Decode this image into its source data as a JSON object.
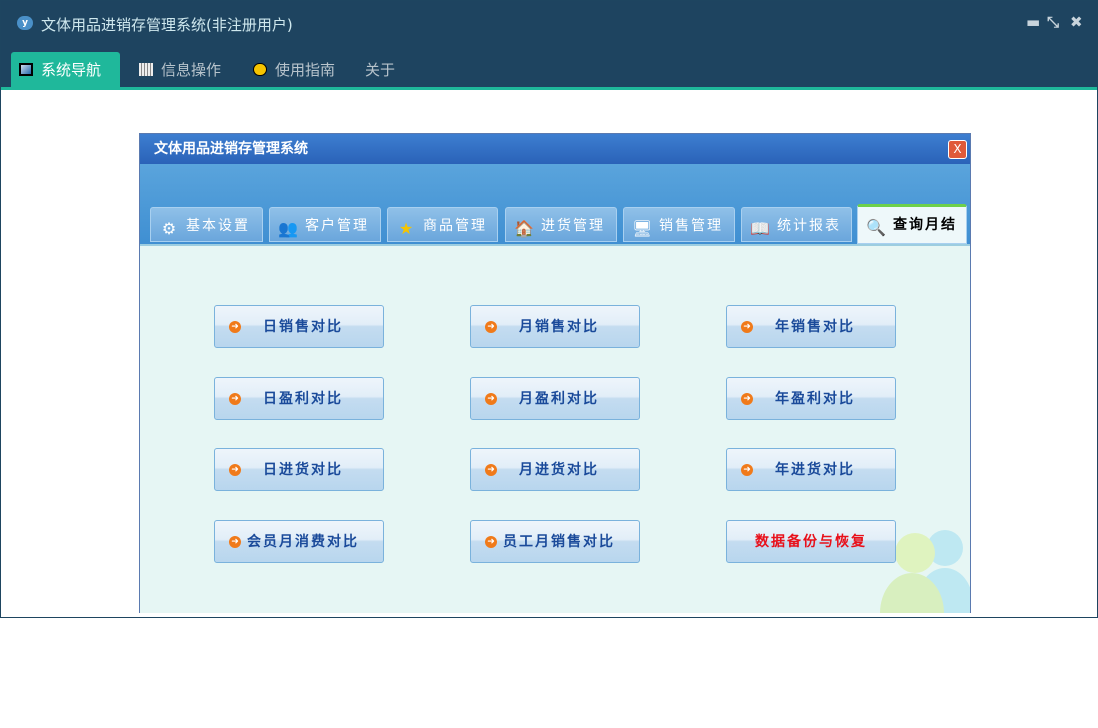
{
  "window": {
    "title": "文体用品进销存管理系统(非注册用户)",
    "minimize": "▬",
    "restore": "⤡",
    "close": "✖"
  },
  "menu": [
    {
      "label": "系统导航",
      "icon": "monitor-icon",
      "active": true
    },
    {
      "label": "信息操作",
      "icon": "grid-icon"
    },
    {
      "label": "使用指南",
      "icon": "help-icon"
    },
    {
      "label": "关于"
    }
  ],
  "inner": {
    "title": "文体用品进销存管理系统",
    "close": "X",
    "tabs": [
      {
        "label": "基本设置",
        "icon": "gear-icon"
      },
      {
        "label": "客户管理",
        "icon": "users-icon"
      },
      {
        "label": "商品管理",
        "icon": "star-icon"
      },
      {
        "label": "进货管理",
        "icon": "house-icon"
      },
      {
        "label": "销售管理",
        "icon": "monitor-icon"
      },
      {
        "label": "统计报表",
        "icon": "book-icon"
      },
      {
        "label": "查询月结",
        "icon": "search-icon",
        "active": true
      }
    ],
    "buttons": [
      "日销售对比",
      "月销售对比",
      "年销售对比",
      "日盈利对比",
      "月盈利对比",
      "年盈利对比",
      "日进货对比",
      "月进货对比",
      "年进货对比",
      "会员月消费对比",
      "员工月销售对比",
      "数据备份与恢复"
    ]
  },
  "colors": {
    "header": "#1e4460",
    "accent": "#1fb89b",
    "danger": "#e8101a"
  }
}
